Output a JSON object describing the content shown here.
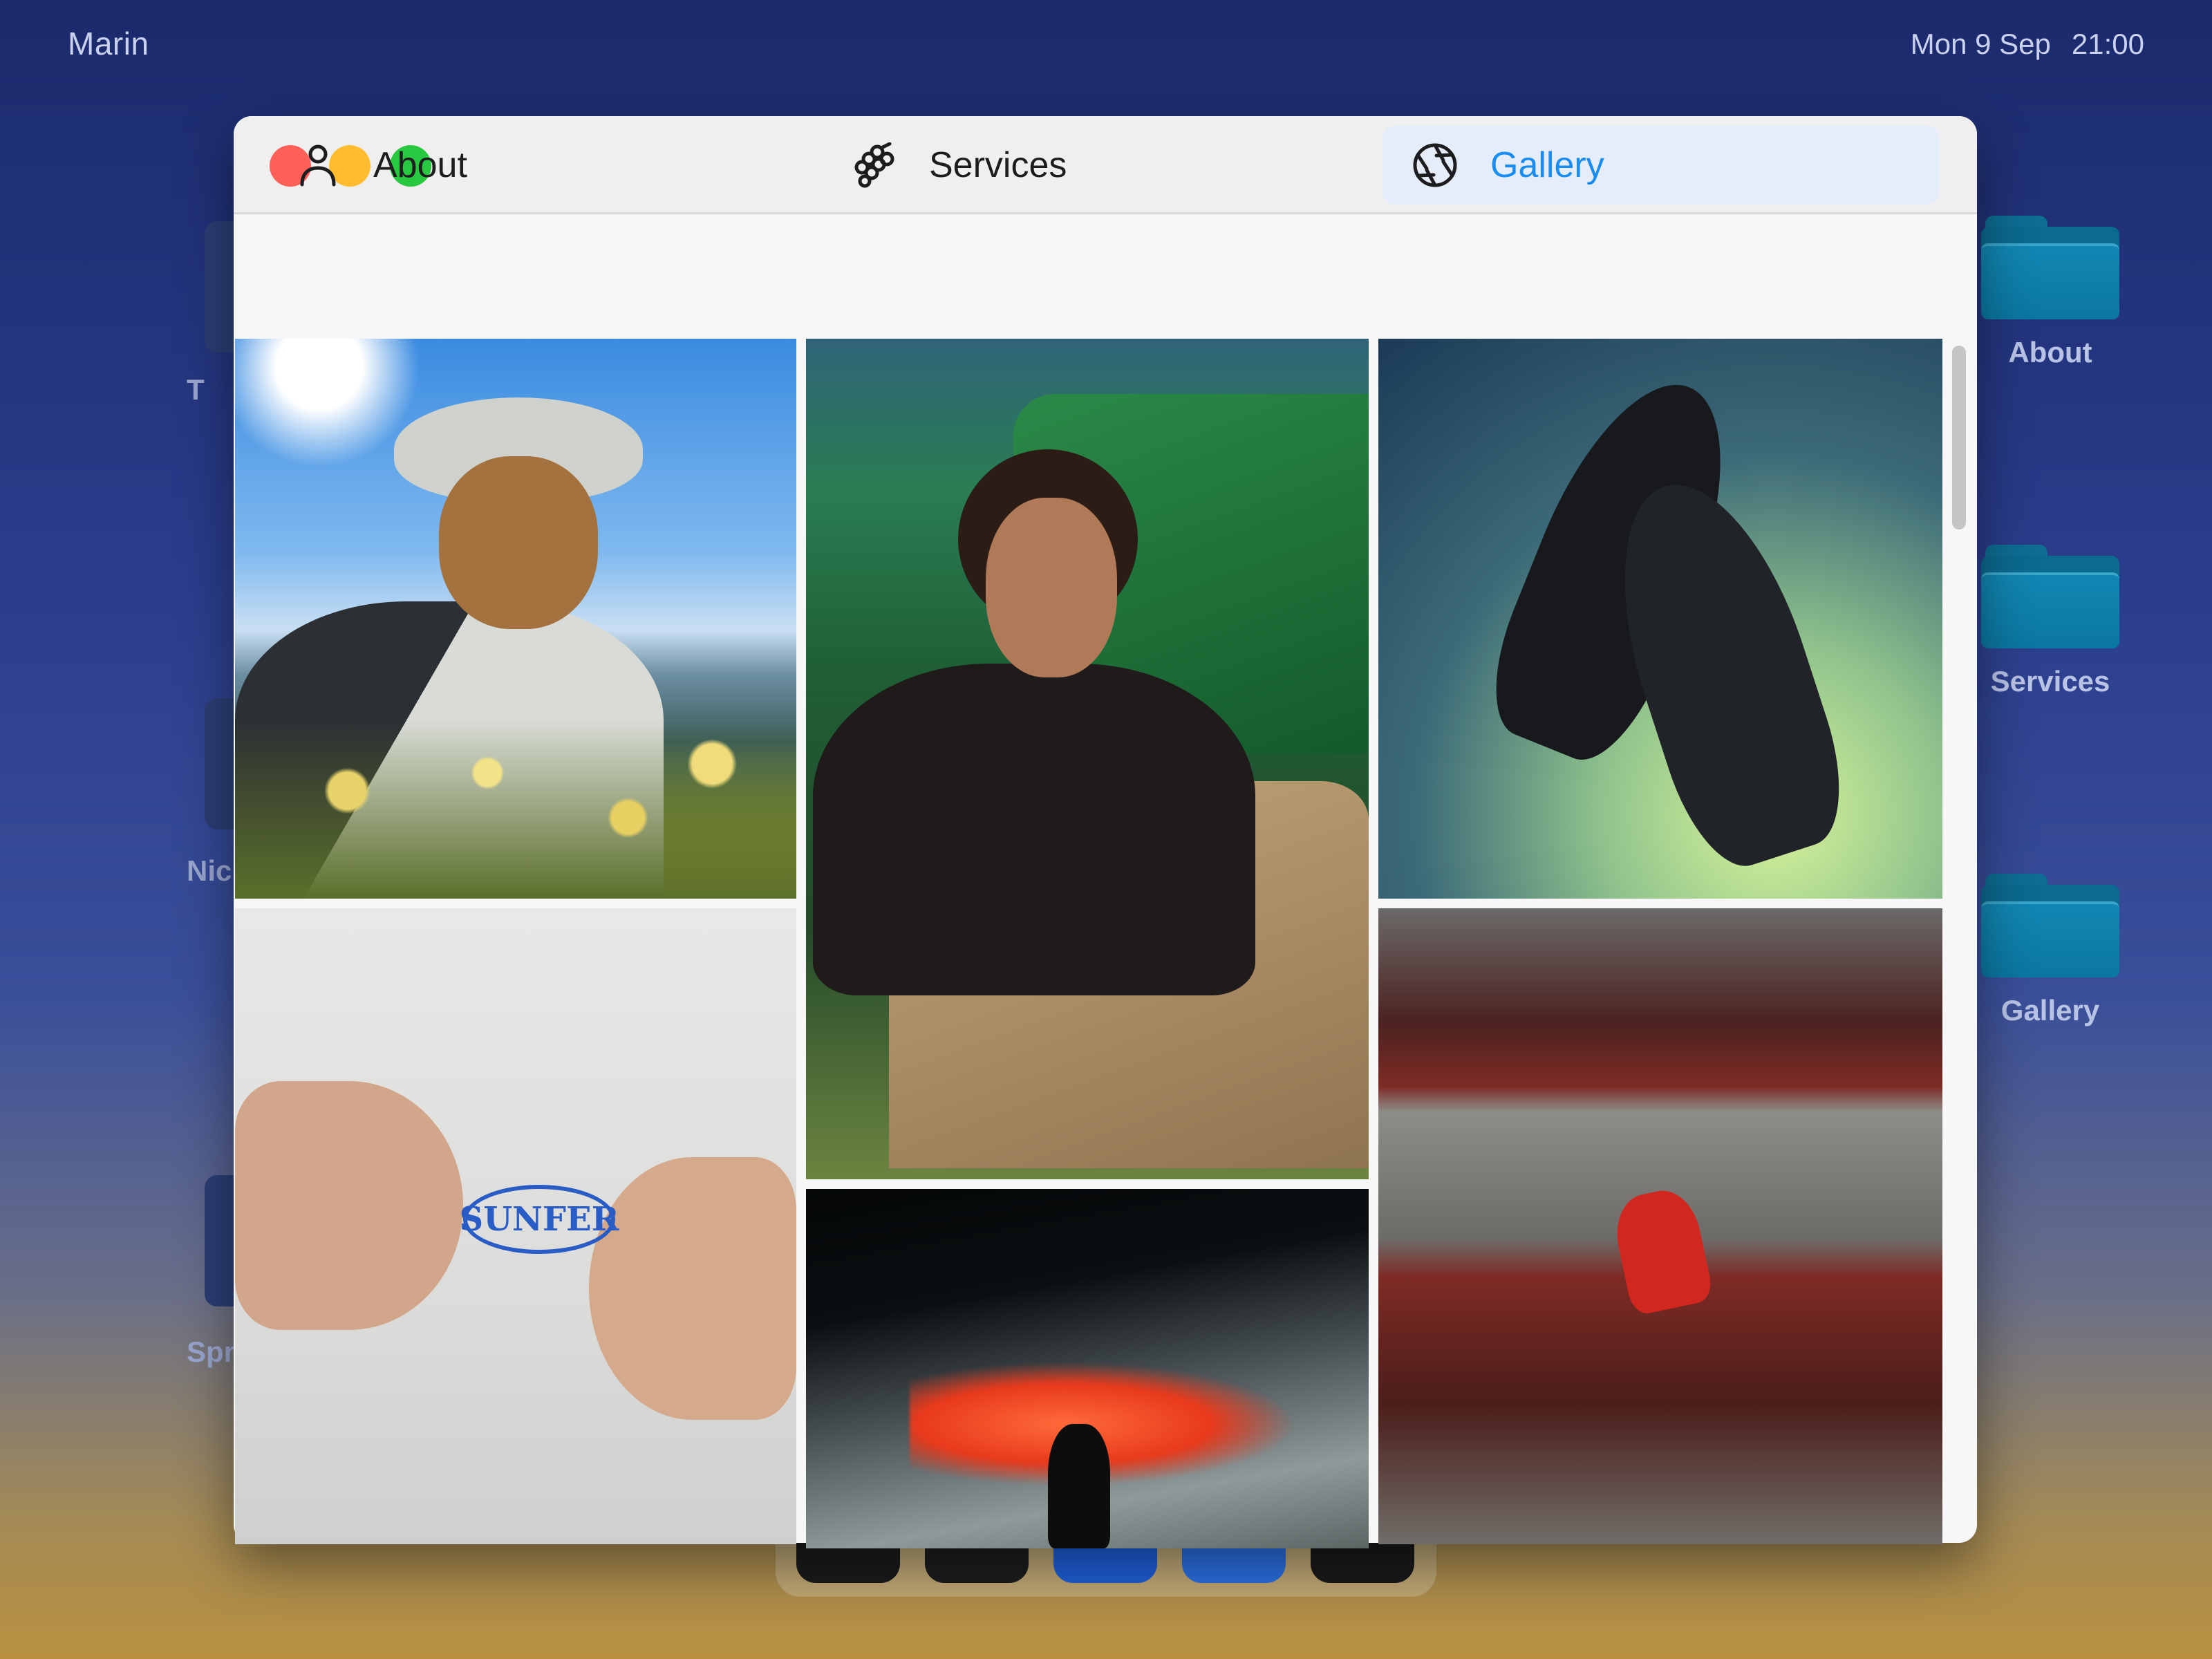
{
  "menubar": {
    "app_name": "Marin",
    "date": "Mon 9 Sep",
    "time": "21:00"
  },
  "desktop": {
    "folders": [
      {
        "label": "About",
        "icon": "folder-icon"
      },
      {
        "label": "Services",
        "icon": "folder-icon"
      },
      {
        "label": "Gallery",
        "icon": "folder-icon"
      }
    ],
    "left_partial_labels": [
      "T",
      "Nic",
      "Spr"
    ]
  },
  "window": {
    "tabs": [
      {
        "label": "About",
        "icon": "person-icon",
        "active": false
      },
      {
        "label": "Services",
        "icon": "grapes-icon",
        "active": false
      },
      {
        "label": "Gallery",
        "icon": "aperture-icon",
        "active": true
      }
    ],
    "gallery": {
      "photos": [
        {
          "alt": "Laughing person in bucket hat on mountain with wildflowers"
        },
        {
          "alt": "Man in black t-shirt sitting against green car"
        },
        {
          "alt": "Two black padel rackets against gradient sky"
        },
        {
          "alt": "White t-shirt with blue logo and hands with blue nails"
        },
        {
          "alt": "Rider and red horses on dark landscape"
        },
        {
          "alt": "Figure in red dress on red benches"
        }
      ],
      "tshirt_logo": "SUNFER"
    }
  },
  "colors": {
    "accent": "#1a8cf0",
    "active_tab_bg": "#e4edf9",
    "close": "#fe5f57",
    "minimize": "#febc2e",
    "zoom": "#28c840",
    "folder": "#1187b3"
  }
}
